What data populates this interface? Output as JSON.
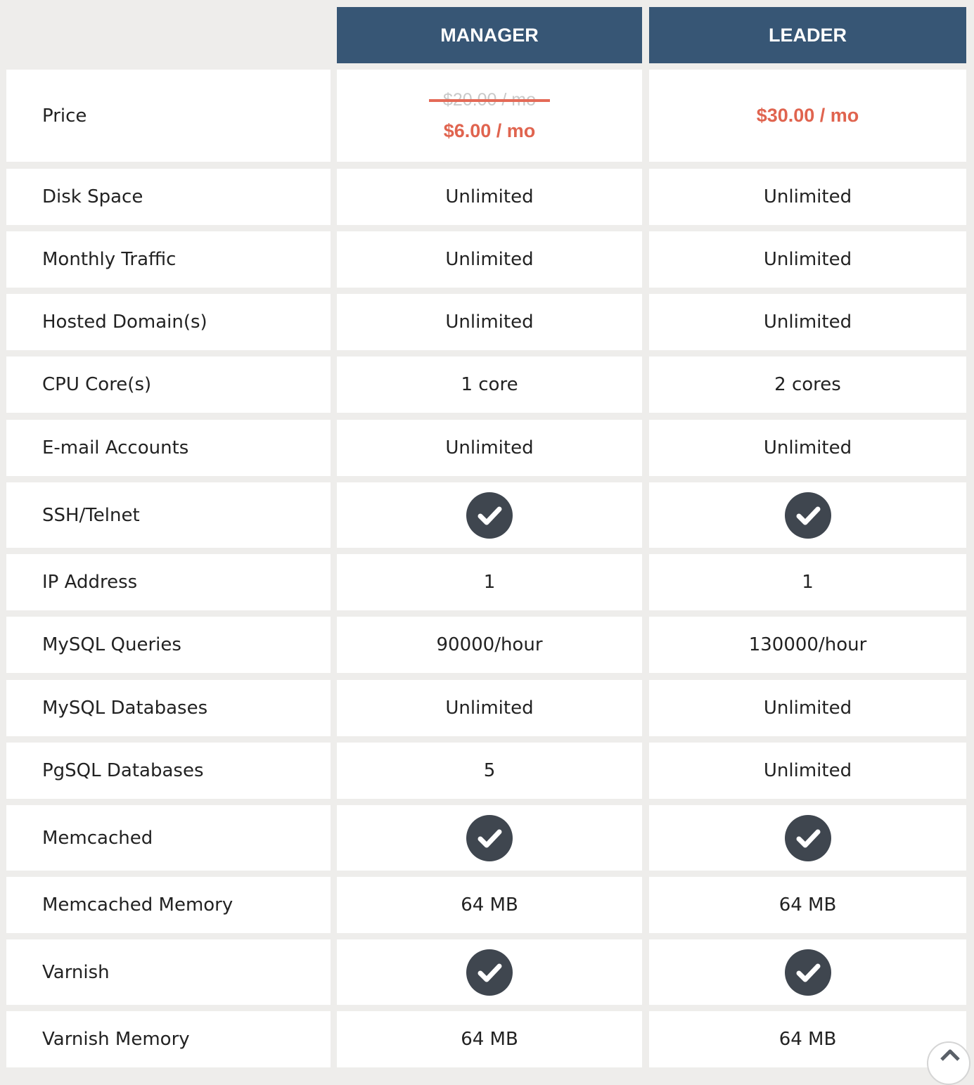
{
  "plans": [
    {
      "name": "MANAGER"
    },
    {
      "name": "LEADER"
    }
  ],
  "price": {
    "label": "Price",
    "manager_old": "$20.00 / mo",
    "manager_new": "$6.00 / mo",
    "leader": "$30.00 / mo"
  },
  "rows": [
    {
      "label": "Disk Space",
      "manager": "Unlimited",
      "leader": "Unlimited"
    },
    {
      "label": "Monthly Traffic",
      "manager": "Unlimited",
      "leader": "Unlimited"
    },
    {
      "label": "Hosted Domain(s)",
      "manager": "Unlimited",
      "leader": "Unlimited"
    },
    {
      "label": "CPU Core(s)",
      "manager": "1 core",
      "leader": "2 cores"
    },
    {
      "label": "E-mail Accounts",
      "manager": "Unlimited",
      "leader": "Unlimited"
    },
    {
      "label": "SSH/Telnet",
      "manager": "check-icon",
      "leader": "check-icon"
    },
    {
      "label": "IP Address",
      "manager": "1",
      "leader": "1"
    },
    {
      "label": "MySQL Queries",
      "manager": "90000/hour",
      "leader": "130000/hour"
    },
    {
      "label": "MySQL Databases",
      "manager": "Unlimited",
      "leader": "Unlimited"
    },
    {
      "label": "PgSQL Databases",
      "manager": "5",
      "leader": "Unlimited"
    },
    {
      "label": "Memcached",
      "manager": "check-icon",
      "leader": "check-icon"
    },
    {
      "label": "Memcached Memory",
      "manager": "64 MB",
      "leader": "64 MB"
    },
    {
      "label": "Varnish",
      "manager": "check-icon",
      "leader": "check-icon"
    },
    {
      "label": "Varnish Memory",
      "manager": "64 MB",
      "leader": "64 MB"
    }
  ],
  "colors": {
    "header_bg": "#375675",
    "price_red": "#e0644f",
    "check_bg": "#3f464f",
    "page_bg": "#eeedeb"
  }
}
